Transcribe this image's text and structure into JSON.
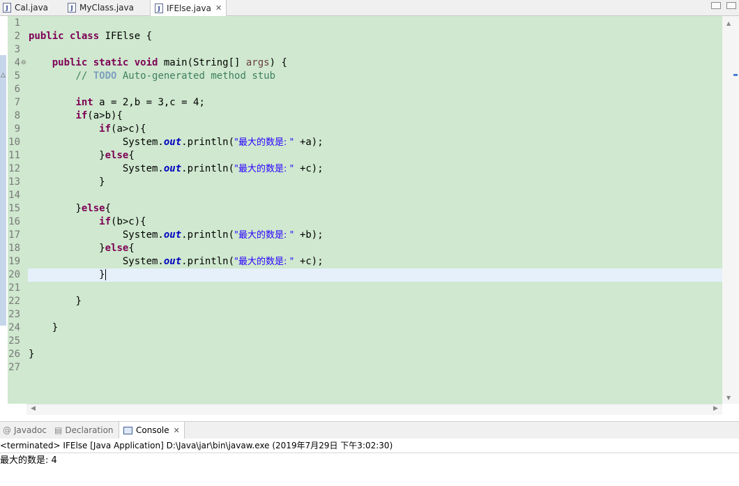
{
  "editor_tabs": [
    {
      "label": "Cal.java",
      "active": false
    },
    {
      "label": "MyClass.java",
      "active": false
    },
    {
      "label": "IFElse.java",
      "active": true
    }
  ],
  "close_glyph": "✕",
  "file_icon_glyph": "J",
  "line_numbers": [
    "1",
    "2",
    "3",
    "4",
    "5",
    "6",
    "7",
    "8",
    "9",
    "10",
    "11",
    "12",
    "13",
    "14",
    "15",
    "16",
    "17",
    "18",
    "19",
    "20",
    "21",
    "22",
    "23",
    "24",
    "25",
    "26",
    "27"
  ],
  "code": {
    "class_kw": "public class",
    "class_name": " IFElse {",
    "main_kw": "public static void",
    "main_sig": " main(String[] ",
    "main_param": "args",
    "main_end": ") {",
    "comment_start": "// ",
    "todo": "TODO",
    "comment_rest": " Auto-generated method stub",
    "int_kw": "int",
    "decl_rest_1": " a = 2,b = 3,c = 4;",
    "if_kw": "if",
    "cond_ab": "(a>b){",
    "cond_ac": "(a>c){",
    "cond_bc": "(b>c){",
    "system": "System.",
    "out": "out",
    "println": ".println(",
    "str": "\"最大的数是: \"",
    "plus_a": " +a);",
    "plus_b": " +b);",
    "plus_c": " +c);",
    "close_else_open": "}",
    "else_kw": "else",
    "open_brace": "{",
    "close_brace": "}"
  },
  "view_tabs": [
    {
      "label": "Javadoc",
      "icon": "at-icon",
      "active": false
    },
    {
      "label": "Declaration",
      "icon": "declaration-icon",
      "active": false
    },
    {
      "label": "Console",
      "icon": "console-icon",
      "active": true
    }
  ],
  "console": {
    "status": "<terminated> IFElse [Java Application] D:\\Java\\jar\\bin\\javaw.exe (2019年7月29日 下午3:02:30)",
    "output": "最大的数是: 4"
  },
  "colors": {
    "editor_background": "#cfe8cf",
    "keyword": "#7f0055",
    "comment": "#3f7f5f",
    "string": "#2a00ff",
    "field": "#0000c0",
    "current_line": "#e6f0fb"
  }
}
